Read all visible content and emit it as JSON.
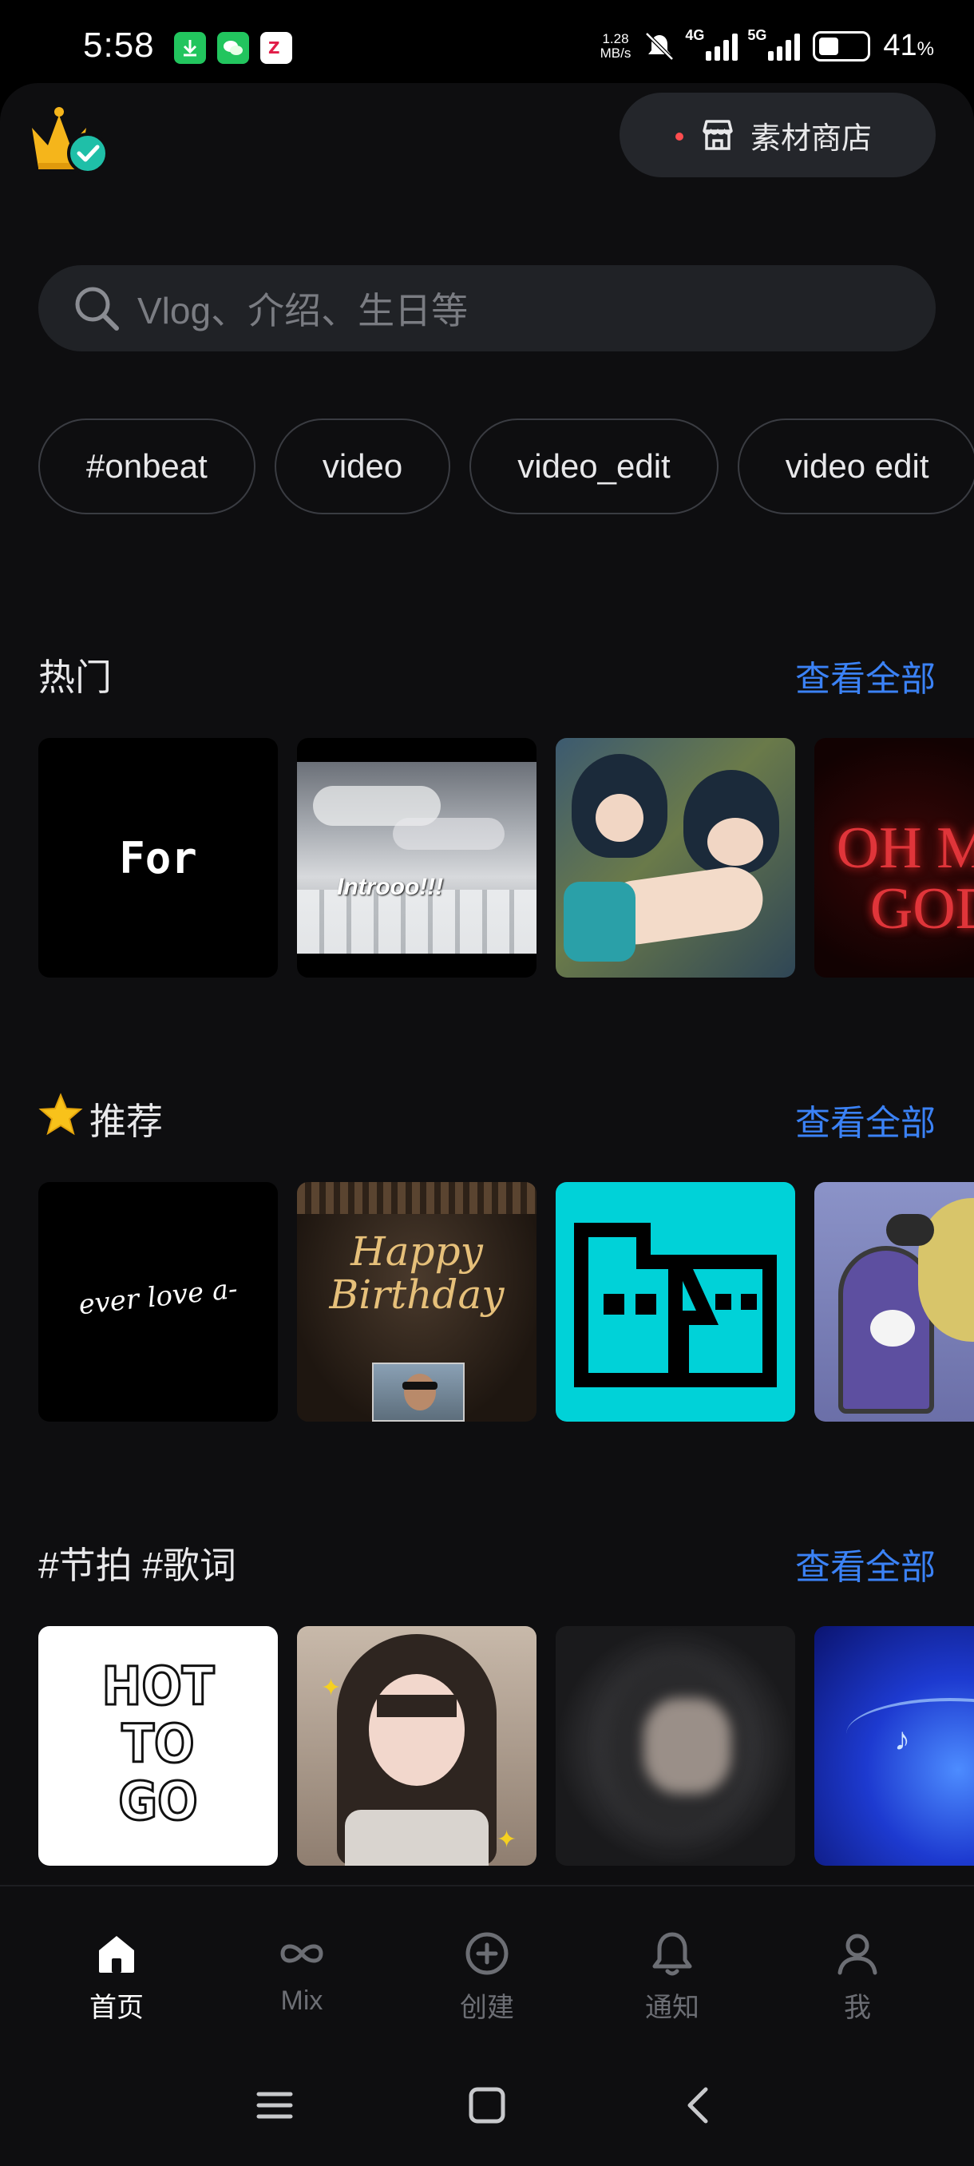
{
  "status_bar": {
    "time": "5:58",
    "net_speed_value": "1.28",
    "net_speed_unit": "MB/s",
    "signal1_tag": "4G",
    "signal2_tag": "5G",
    "battery_percent": "41",
    "battery_unit": "%"
  },
  "header": {
    "store_label": "素材商店"
  },
  "search": {
    "placeholder": "Vlog、介绍、生日等"
  },
  "chips": [
    "#onbeat",
    "video",
    "video_edit",
    "video edit"
  ],
  "sections": {
    "hot": {
      "title": "热门",
      "see_all": "查看全部",
      "items": [
        "For",
        "Introoo!!!",
        "",
        "OH MY GOD"
      ]
    },
    "recommended": {
      "title": "推荐",
      "see_all": "查看全部",
      "items": [
        "ever love a-",
        "Happy Birthday",
        "",
        ""
      ]
    },
    "beat_lyrics": {
      "title": "#节拍 #歌词",
      "see_all": "查看全部",
      "items": [
        "HOT TO GO",
        "",
        "",
        ""
      ]
    }
  },
  "bottom_nav": {
    "home": "首页",
    "mix": "Mix",
    "create": "创建",
    "notify": "通知",
    "me": "我"
  },
  "colors": {
    "accent_blue": "#3b82f6",
    "background": "#0e0e10",
    "crown_gold": "#f5b51b",
    "badge_teal": "#1fbfa8"
  }
}
